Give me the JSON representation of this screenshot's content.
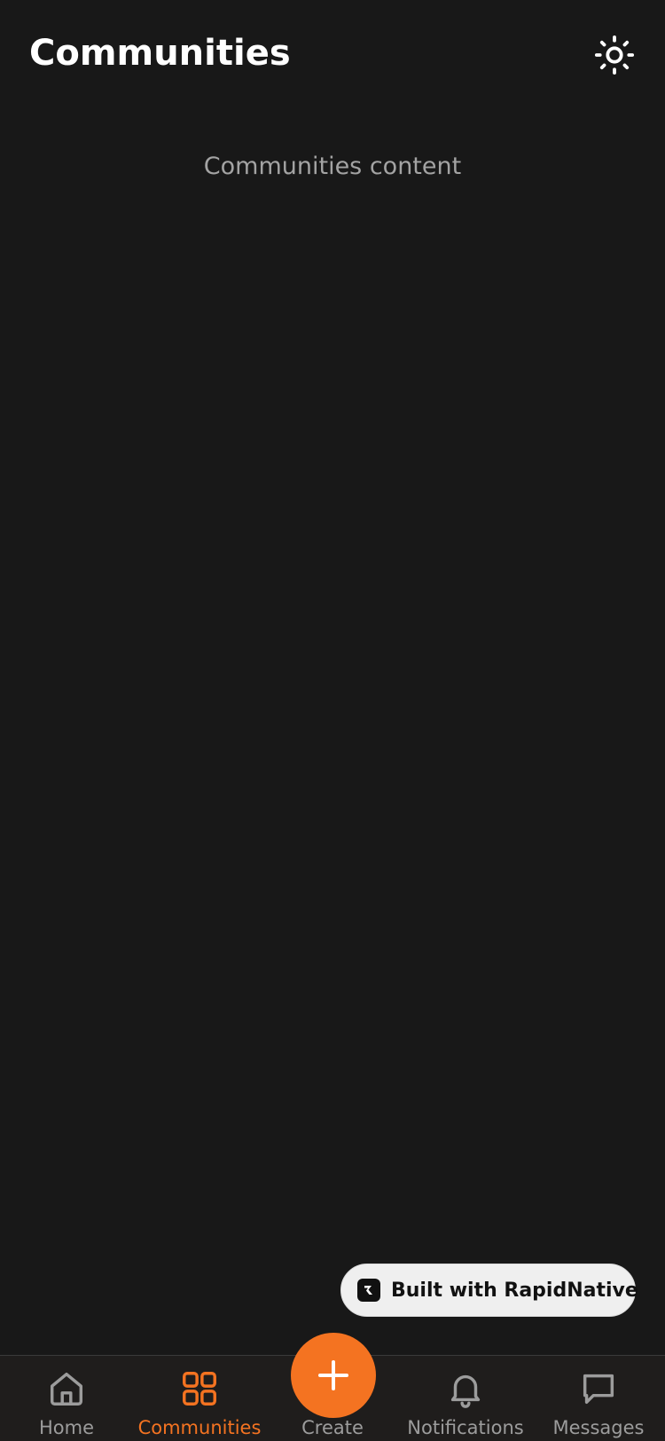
{
  "header": {
    "title": "Communities",
    "theme_icon": "sun-icon"
  },
  "main": {
    "content_text": "Communities content"
  },
  "badge": {
    "label": "Built with RapidNative",
    "icon": "rapidnative-logo-icon"
  },
  "tabbar": {
    "tabs": [
      {
        "label": "Home",
        "icon": "home-icon",
        "active": false
      },
      {
        "label": "Communities",
        "icon": "grid-icon",
        "active": true
      },
      {
        "label": "Create",
        "icon": "plus-icon",
        "active": false
      },
      {
        "label": "Notifications",
        "icon": "bell-icon",
        "active": false
      },
      {
        "label": "Messages",
        "icon": "message-icon",
        "active": false
      }
    ]
  },
  "colors": {
    "background": "#181818",
    "accent": "#f47321",
    "inactive": "#9c9c9c",
    "tabbar_background": "#1f1d1c"
  }
}
